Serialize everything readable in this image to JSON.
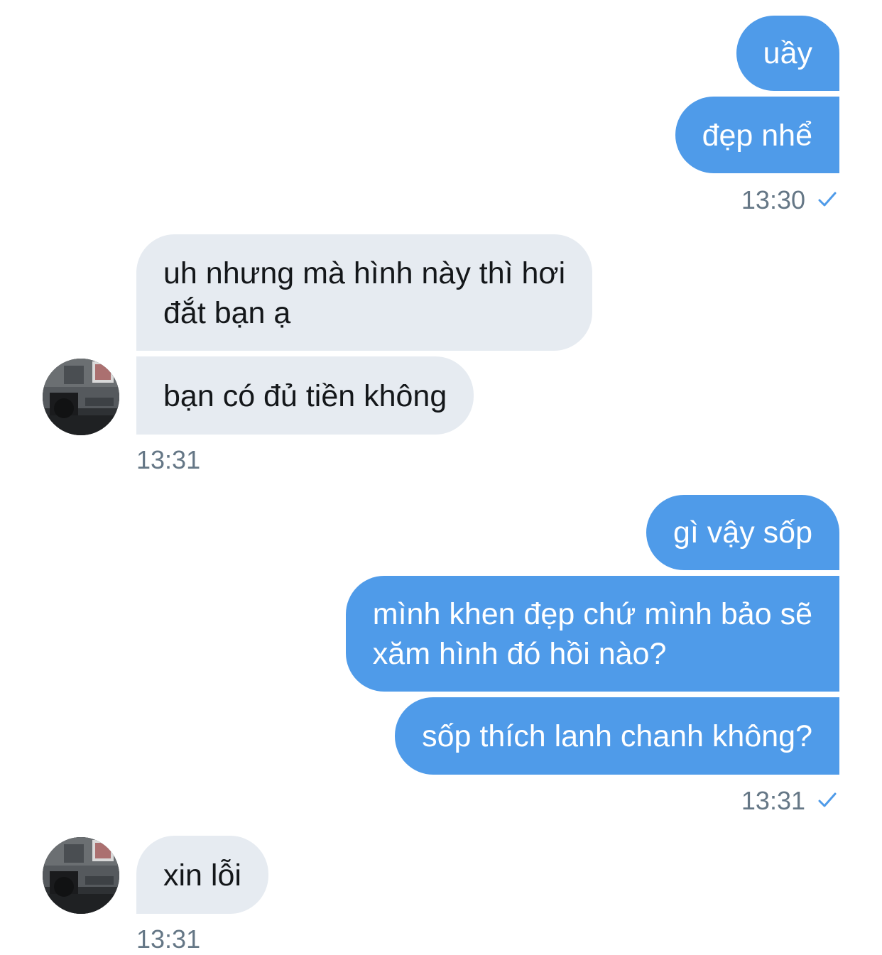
{
  "messages": [
    {
      "text": "uầy"
    },
    {
      "text": "đẹp nhể"
    },
    {
      "text": "uh nhưng mà hình này thì hơi đắt bạn ạ",
      "lines": [
        "uh nhưng mà hình này thì hơi",
        "đắt bạn ạ"
      ]
    },
    {
      "text": "bạn có đủ tiền không"
    },
    {
      "text": "gì vậy sốp"
    },
    {
      "text": "mình khen đẹp chứ mình bảo sẽ xăm hình đó hồi nào?",
      "lines": [
        "mình khen đẹp chứ mình bảo sẽ",
        "xăm hình đó hồi nào?"
      ]
    },
    {
      "text": "sốp thích lanh chanh không?"
    },
    {
      "text": "xin lỗi"
    }
  ],
  "timestamps": {
    "t1": "13:30",
    "t2": "13:31",
    "t3": "13:31",
    "t4": "13:31"
  },
  "icons": {
    "read_receipt": "checkmark-icon",
    "avatar": "contact-avatar"
  },
  "colors": {
    "outgoing_bubble": "#4f9be9",
    "incoming_bubble": "#e6ebf1",
    "timestamp": "#657786",
    "checkmark": "#4f9be9"
  }
}
